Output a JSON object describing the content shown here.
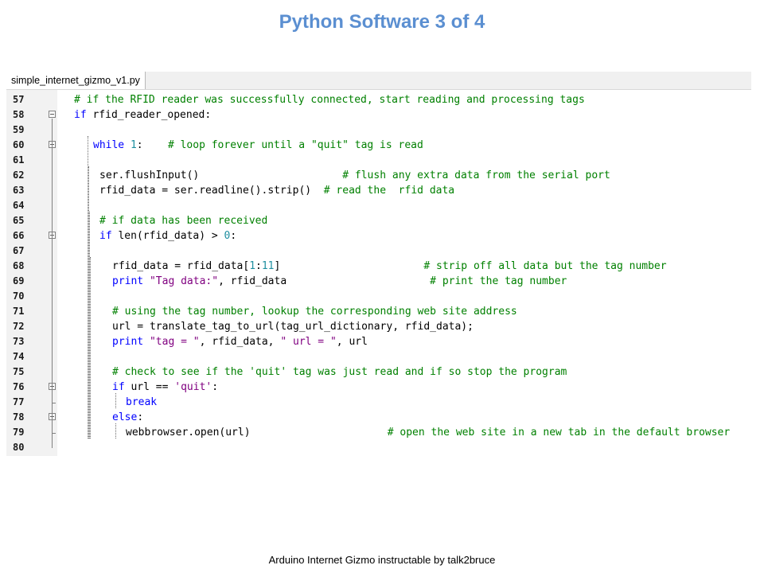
{
  "slide": {
    "title": "Python Software 3 of 4",
    "footer": "Arduino  Internet  Gizmo  instructable by talk2bruce"
  },
  "editor": {
    "tab_label": "simple_internet_gizmo_v1.py",
    "lines": [
      {
        "n": "57",
        "code": "# if the RFID reader was successfully connected, start reading and processing tags"
      },
      {
        "n": "58",
        "code": "if rfid_reader_opened:"
      },
      {
        "n": "59",
        "code": ""
      },
      {
        "n": "60",
        "code": "while 1:    # loop forever until a \"quit\" tag is read"
      },
      {
        "n": "61",
        "code": ""
      },
      {
        "n": "62",
        "code": "ser.flushInput()                       # flush any extra data from the serial port"
      },
      {
        "n": "63",
        "code": "rfid_data = ser.readline().strip()  # read the  rfid data"
      },
      {
        "n": "64",
        "code": ""
      },
      {
        "n": "65",
        "code": "# if data has been received"
      },
      {
        "n": "66",
        "code": "if len(rfid_data) > 0:"
      },
      {
        "n": "67",
        "code": ""
      },
      {
        "n": "68",
        "code": "rfid_data = rfid_data[1:11]                       # strip off all data but the tag number"
      },
      {
        "n": "69",
        "code": "print \"Tag data:\", rfid_data                       # print the tag number"
      },
      {
        "n": "70",
        "code": ""
      },
      {
        "n": "71",
        "code": "# using the tag number, lookup the corresponding web site address"
      },
      {
        "n": "72",
        "code": "url = translate_tag_to_url(tag_url_dictionary, rfid_data);"
      },
      {
        "n": "73",
        "code": "print \"tag = \", rfid_data, \" url = \", url"
      },
      {
        "n": "74",
        "code": ""
      },
      {
        "n": "75",
        "code": "# check to see if the 'quit' tag was just read and if so stop the program"
      },
      {
        "n": "76",
        "code": "if url == 'quit':"
      },
      {
        "n": "77",
        "code": "break"
      },
      {
        "n": "78",
        "code": "else:"
      },
      {
        "n": "79",
        "code": "webbrowser.open(url)                      # open the web site in a new tab in the default browser"
      },
      {
        "n": "80",
        "code": ""
      }
    ]
  },
  "colors": {
    "title": "#5b8fd1",
    "comment": "#008000",
    "keyword": "#0000ff",
    "string": "#800080",
    "number": "#1f8fa0",
    "gutter": "#f2f2f2"
  }
}
